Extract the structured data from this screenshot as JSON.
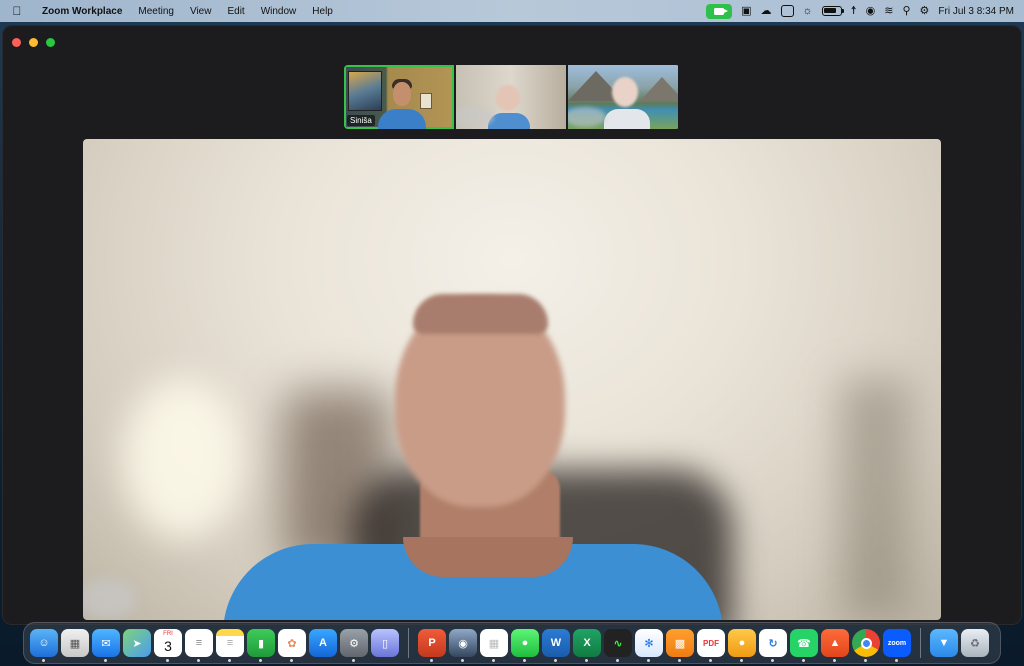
{
  "menubar": {
    "app_name": "Zoom Workplace",
    "items": [
      "Meeting",
      "View",
      "Edit",
      "Window",
      "Help"
    ],
    "clock": "Fri Jul 3  8:34 PM",
    "icons": [
      "zoom-camera-icon",
      "app-box-icon",
      "cloud-icon",
      "printer-icon",
      "brightness-icon",
      "battery-icon",
      "hearing-icon",
      "vpn-icon",
      "wifi-icon",
      "search-icon",
      "control-center-icon"
    ]
  },
  "meeting": {
    "participants": [
      {
        "name": "Siniša",
        "active": true
      },
      {
        "name": "",
        "active": false
      },
      {
        "name": "",
        "active": false
      }
    ]
  },
  "dock": {
    "calendar": {
      "day": "FRI",
      "date": "3"
    },
    "zoom_label": "zoom",
    "pdf_label": "PDF",
    "apps": [
      "finder",
      "launchpad",
      "mail",
      "maps",
      "calendar",
      "reminders",
      "notes",
      "numbers",
      "photos",
      "app-store",
      "system-settings",
      "simulator",
      "powerpoint",
      "dictionary",
      "tables",
      "messages",
      "word",
      "excel",
      "activity-monitor",
      "safari",
      "books",
      "pdf-expert",
      "coins",
      "quickshare",
      "whatsapp",
      "brave",
      "chrome",
      "zoom",
      "downloads-folder",
      "trash"
    ]
  },
  "colors": {
    "active_speaker": "#39c24a",
    "close": "#ff5f57",
    "minimize": "#febc2e",
    "maximize": "#28c840",
    "window_bg": "#1c1c1e"
  }
}
